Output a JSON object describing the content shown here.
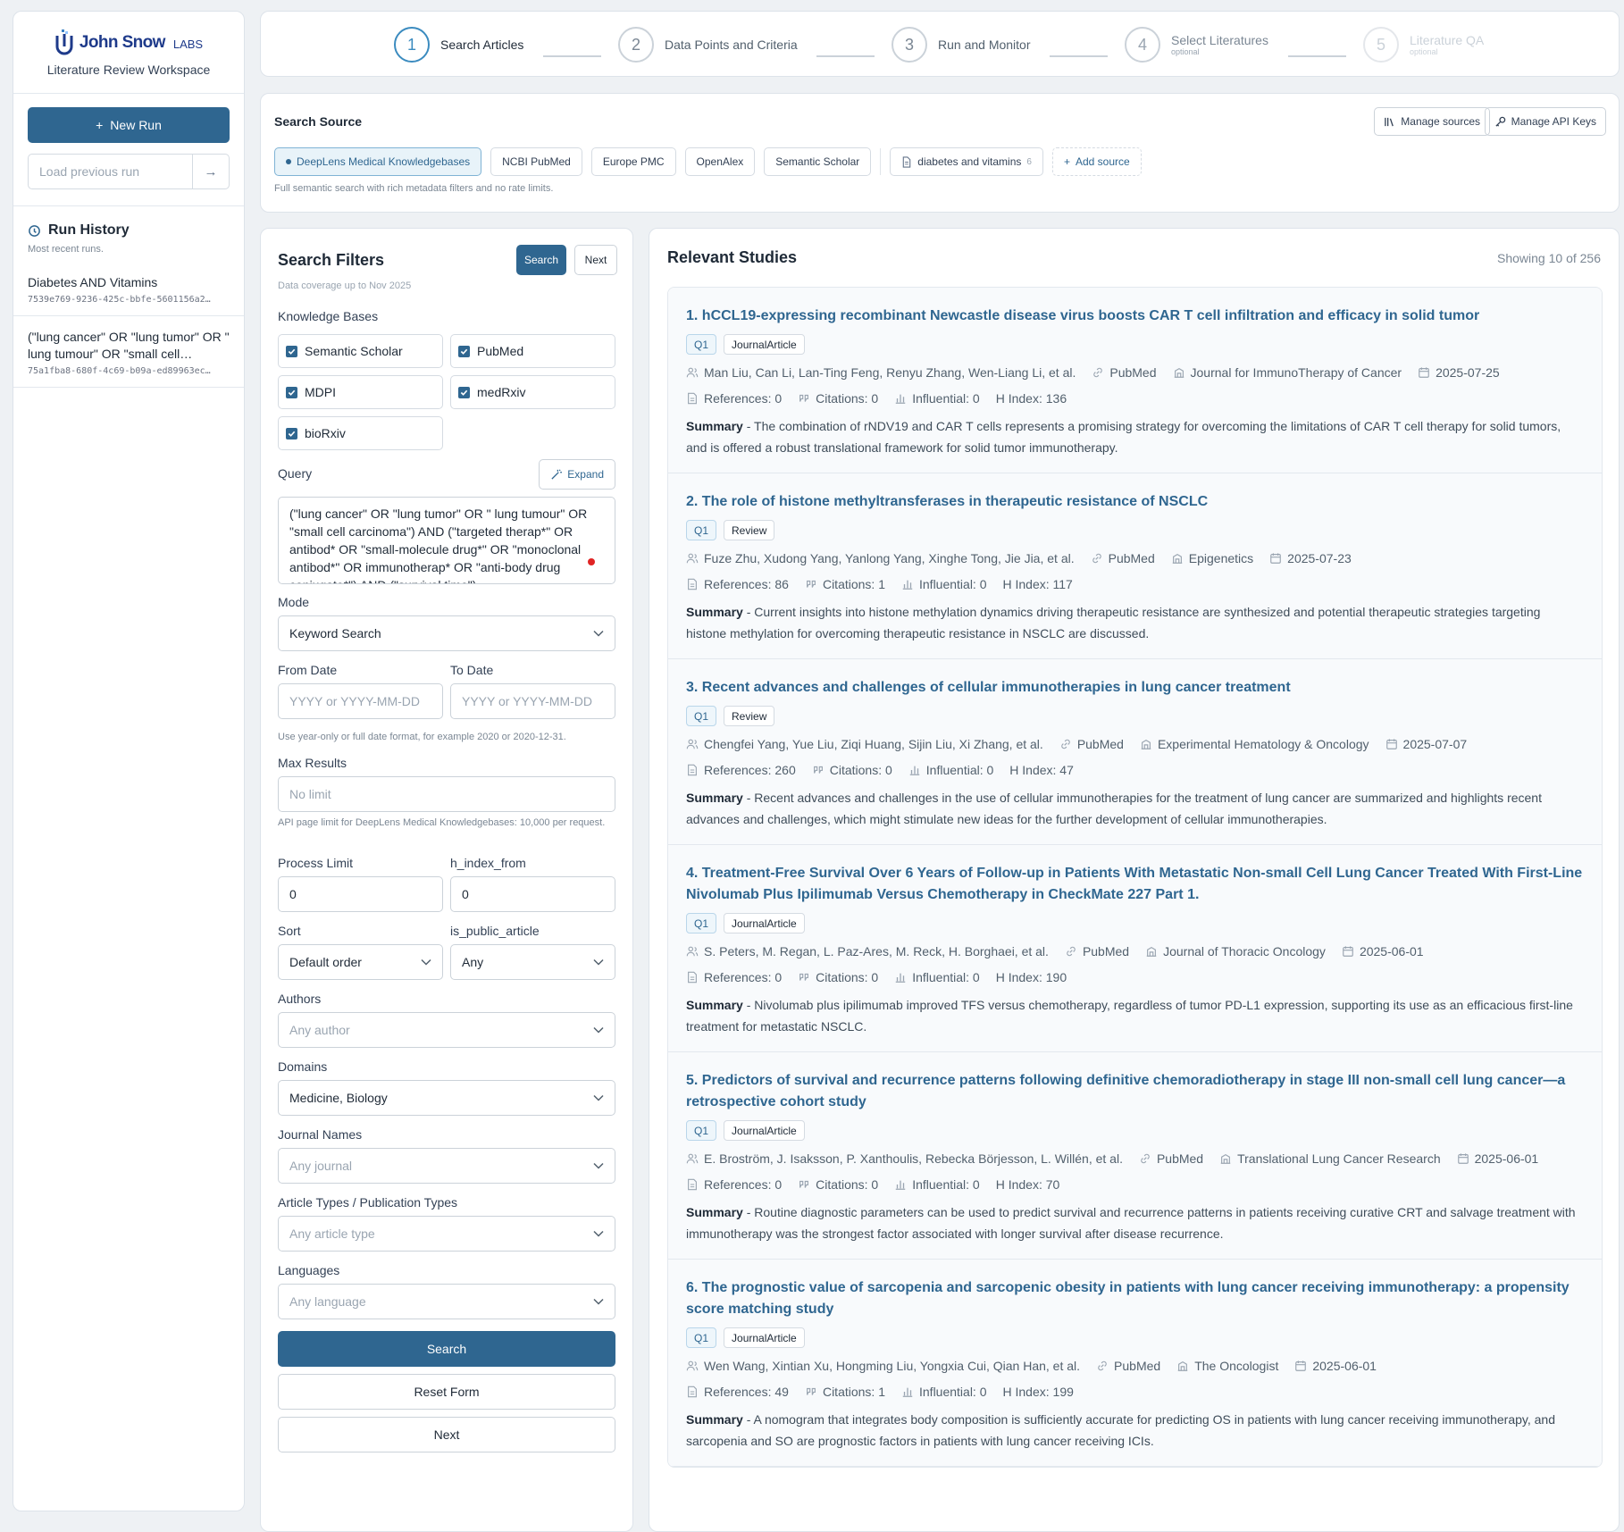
{
  "brand": {
    "name": "John Snow",
    "suffix": "LABS",
    "workspace": "Literature Review Workspace"
  },
  "sidebar": {
    "new_run": "New Run",
    "load_placeholder": "Load previous run",
    "history_title": "Run History",
    "history_sub": "Most recent runs.",
    "runs": [
      {
        "title": "Diabetes AND Vitamins",
        "id": "7539e769-9236-425c-bbfe-5601156a2…"
      },
      {
        "title": "(\"lung cancer\" OR \"lung tumor\" OR \" lung tumour\" OR \"small cell…",
        "id": "75a1fba8-680f-4c69-b09a-ed89963ec…"
      }
    ]
  },
  "steps": [
    {
      "num": "1",
      "label": "Search Articles",
      "optional": ""
    },
    {
      "num": "2",
      "label": "Data Points and Criteria",
      "optional": ""
    },
    {
      "num": "3",
      "label": "Run and Monitor",
      "optional": ""
    },
    {
      "num": "4",
      "label": "Select Literatures",
      "optional": "optional"
    },
    {
      "num": "5",
      "label": "Literature QA",
      "optional": "optional"
    }
  ],
  "source": {
    "title": "Search Source",
    "manage_sources": "Manage sources",
    "manage_keys": "Manage API Keys",
    "chips": [
      "DeepLens Medical Knowledgebases",
      "NCBI PubMed",
      "Europe PMC",
      "OpenAlex",
      "Semantic Scholar"
    ],
    "custom_chip": "diabetes and vitamins",
    "custom_count": "6",
    "add_source": "Add source",
    "hint": "Full semantic search with rich metadata filters and no rate limits."
  },
  "filters": {
    "title": "Search Filters",
    "search_btn": "Search",
    "next_btn": "Next",
    "coverage": "Data coverage up to Nov 2025",
    "kb_label": "Knowledge Bases",
    "kbs": [
      "Semantic Scholar",
      "PubMed",
      "MDPI",
      "medRxiv",
      "bioRxiv"
    ],
    "query_label": "Query",
    "expand": "Expand",
    "query": "(\"lung cancer\" OR \"lung tumor\" OR \" lung tumour\" OR \"small cell carcinoma\") AND (\"targeted therap*\" OR antibod* OR \"small-molecule drug*\" OR \"monoclonal antibod*\" OR immunotherap* OR \"anti-body drug conjugate*\") AND (\"survival time\")",
    "mode_label": "Mode",
    "mode": "Keyword Search",
    "from_label": "From Date",
    "to_label": "To Date",
    "date_placeholder": "YYYY or YYYY-MM-DD",
    "date_note": "Use year-only or full date format, for example 2020 or 2020-12-31.",
    "max_label": "Max Results",
    "max_placeholder": "No limit",
    "max_note": "API page limit for DeepLens Medical Knowledgebases: 10,000 per request.",
    "process_label": "Process Limit",
    "process_value": "0",
    "hindex_label": "h_index_from",
    "hindex_value": "0",
    "sort_label": "Sort",
    "sort_value": "Default order",
    "public_label": "is_public_article",
    "public_value": "Any",
    "authors_label": "Authors",
    "authors_value": "Any author",
    "domains_label": "Domains",
    "domains_value": "Medicine, Biology",
    "journals_label": "Journal Names",
    "journals_value": "Any journal",
    "types_label": "Article Types / Publication Types",
    "types_value": "Any article type",
    "lang_label": "Languages",
    "lang_value": "Any language",
    "search_full": "Search",
    "reset": "Reset Form",
    "next_full": "Next"
  },
  "results": {
    "title": "Relevant Studies",
    "count": "Showing 10 of 256",
    "summary_label": "Summary",
    "studies": [
      {
        "title": "1. hCCL19-expressing recombinant Newcastle disease virus boosts CAR T cell infiltration and efficacy in solid tumor",
        "quartile": "Q1",
        "type": "JournalArticle",
        "authors": "Man Liu, Can Li, Lan-Ting Feng, Renyu Zhang, Wen-Liang Li, et al.",
        "source": "PubMed",
        "journal": "Journal for ImmunoTherapy of Cancer",
        "date": "2025-07-25",
        "references": "References: 0",
        "citations": "Citations: 0",
        "influential": "Influential: 0",
        "hindex": "H Index: 136",
        "summary": "The combination of rNDV19 and CAR T cells represents a promising strategy for overcoming the limitations of CAR T cell therapy for solid tumors, and is offered a robust translational framework for solid tumor immunotherapy."
      },
      {
        "title": "2. The role of histone methyltransferases in therapeutic resistance of NSCLC",
        "quartile": "Q1",
        "type": "Review",
        "authors": "Fuze Zhu, Xudong Yang, Yanlong Yang, Xinghe Tong, Jie Jia, et al.",
        "source": "PubMed",
        "journal": "Epigenetics",
        "date": "2025-07-23",
        "references": "References: 86",
        "citations": "Citations: 1",
        "influential": "Influential: 0",
        "hindex": "H Index: 117",
        "summary": "Current insights into histone methylation dynamics driving therapeutic resistance are synthesized and potential therapeutic strategies targeting histone methylation for overcoming therapeutic resistance in NSCLC are discussed."
      },
      {
        "title": "3. Recent advances and challenges of cellular immunotherapies in lung cancer treatment",
        "quartile": "Q1",
        "type": "Review",
        "authors": "Chengfei Yang, Yue Liu, Ziqi Huang, Sijin Liu, Xi Zhang, et al.",
        "source": "PubMed",
        "journal": "Experimental Hematology & Oncology",
        "date": "2025-07-07",
        "references": "References: 260",
        "citations": "Citations: 0",
        "influential": "Influential: 0",
        "hindex": "H Index: 47",
        "summary": "Recent advances and challenges in the use of cellular immunotherapies for the treatment of lung cancer are summarized and highlights recent advances and challenges, which might stimulate new ideas for the further development of cellular immunotherapies."
      },
      {
        "title": "4. Treatment-Free Survival Over 6 Years of Follow-up in Patients With Metastatic Non-small Cell Lung Cancer Treated With First-Line Nivolumab Plus Ipilimumab Versus Chemotherapy in CheckMate 227 Part 1.",
        "quartile": "Q1",
        "type": "JournalArticle",
        "authors": "S. Peters, M. Regan, L. Paz-Ares, M. Reck, H. Borghaei, et al.",
        "source": "PubMed",
        "journal": "Journal of Thoracic Oncology",
        "date": "2025-06-01",
        "references": "References: 0",
        "citations": "Citations: 0",
        "influential": "Influential: 0",
        "hindex": "H Index: 190",
        "summary": "Nivolumab plus ipilimumab improved TFS versus chemotherapy, regardless of tumor PD-L1 expression, supporting its use as an efficacious first-line treatment for metastatic NSCLC."
      },
      {
        "title": "5. Predictors of survival and recurrence patterns following definitive chemoradiotherapy in stage III non-small cell lung cancer—a retrospective cohort study",
        "quartile": "Q1",
        "type": "JournalArticle",
        "authors": "E. Broström, J. Isaksson, P. Xanthoulis, Rebecka Börjesson, L. Willén, et al.",
        "source": "PubMed",
        "journal": "Translational Lung Cancer Research",
        "date": "2025-06-01",
        "references": "References: 0",
        "citations": "Citations: 0",
        "influential": "Influential: 0",
        "hindex": "H Index: 70",
        "summary": "Routine diagnostic parameters can be used to predict survival and recurrence patterns in patients receiving curative CRT and salvage treatment with immunotherapy was the strongest factor associated with longer survival after disease recurrence."
      },
      {
        "title": "6. The prognostic value of sarcopenia and sarcopenic obesity in patients with lung cancer receiving immunotherapy: a propensity score matching study",
        "quartile": "Q1",
        "type": "JournalArticle",
        "authors": "Wen Wang, Xintian Xu, Hongming Liu, Yongxia Cui, Qian Han, et al.",
        "source": "PubMed",
        "journal": "The Oncologist",
        "date": "2025-06-01",
        "references": "References: 49",
        "citations": "Citations: 1",
        "influential": "Influential: 0",
        "hindex": "H Index: 199",
        "summary": "A nomogram that integrates body composition is sufficiently accurate for predicting OS in patients with lung cancer receiving immunotherapy, and sarcopenia and SO are prognostic factors in patients with lung cancer receiving ICIs."
      }
    ]
  }
}
